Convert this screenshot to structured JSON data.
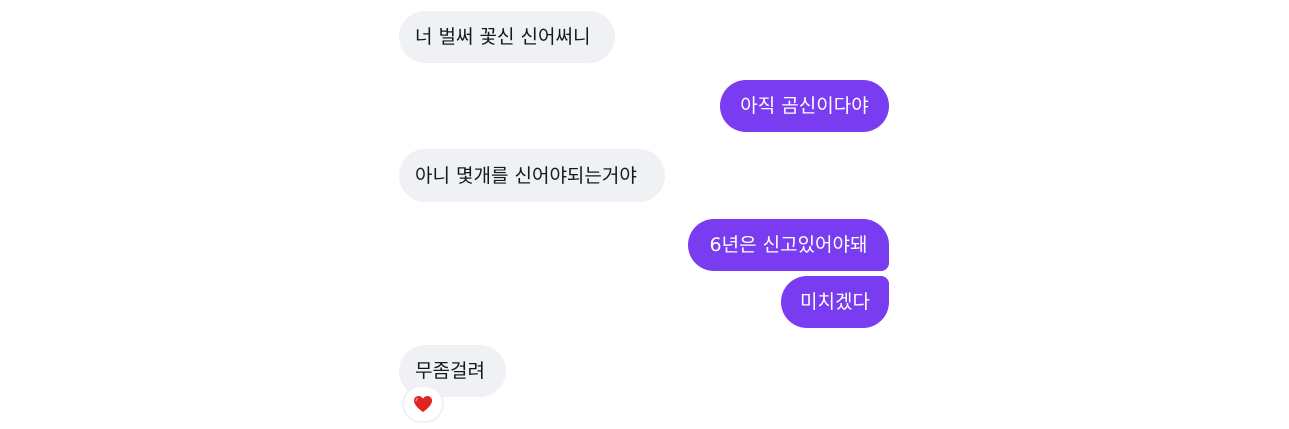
{
  "messages": [
    {
      "id": "m1",
      "direction": "incoming",
      "text": "너 벌써 꽃신 신어써니"
    },
    {
      "id": "m2",
      "direction": "outgoing",
      "text": "아직 곰신이다야"
    },
    {
      "id": "m3",
      "direction": "incoming",
      "text": "아니 몇개를 신어야되는거야"
    },
    {
      "id": "m4",
      "direction": "outgoing",
      "text": "6년은 신고있어야돼"
    },
    {
      "id": "m5",
      "direction": "outgoing",
      "text": "미치겠다"
    },
    {
      "id": "m6",
      "direction": "incoming",
      "text": "무좀걸려"
    }
  ],
  "reaction": {
    "icon": "red-heart-icon",
    "color": "#e02424"
  },
  "colors": {
    "incoming_bubble": "#eff1f4",
    "outgoing_bubble": "#7a3cf0",
    "incoming_text": "#16181b",
    "outgoing_text": "#ffffff"
  }
}
